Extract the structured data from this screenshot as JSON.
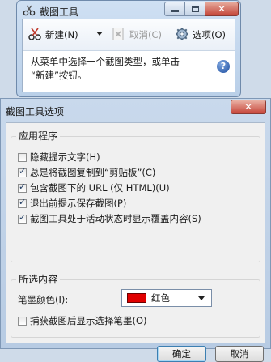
{
  "snip_window": {
    "title": "截图工具",
    "close_glyph": "✕",
    "toolbar": {
      "new_label": "新建(N)",
      "cancel_label": "取消(C)",
      "options_label": "选项(O)"
    },
    "message_line1": "从菜单中选择一个截图类型，或单击",
    "message_line2": "“新建”按钮。",
    "help_glyph": "?"
  },
  "dialog": {
    "title": "截图工具选项",
    "close_glyph": "✕",
    "app_group": {
      "label": "应用程序",
      "options": [
        {
          "label": "隐藏提示文字(H)",
          "checked": false
        },
        {
          "label": "总是将截图复制到“剪贴板”(C)",
          "checked": true
        },
        {
          "label": "包含截图下的 URL (仅 HTML)(U)",
          "checked": true
        },
        {
          "label": "退出前提示保存截图(P)",
          "checked": true
        },
        {
          "label": "截图工具处于活动状态时显示覆盖内容(S)",
          "checked": true
        }
      ]
    },
    "selection_group": {
      "label": "所选内容",
      "pen_color_label": "笔墨颜色(I):",
      "pen_color_value": "红色",
      "pen_color_hex": "#e00000",
      "capture_option": {
        "label": "捕获截图后显示选择笔墨(O)",
        "checked": false
      }
    },
    "ok_label": "确定",
    "cancel_label": "取消"
  }
}
